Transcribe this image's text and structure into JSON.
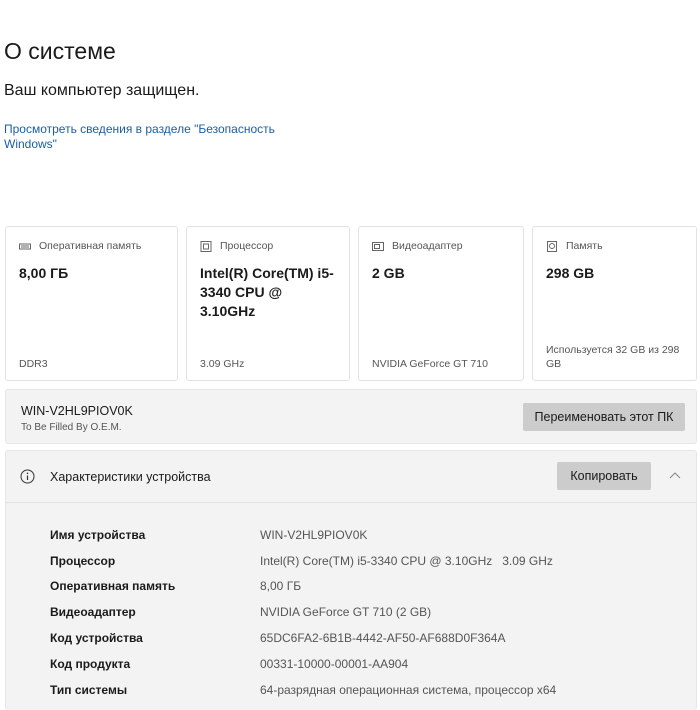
{
  "page": {
    "title": "О системе",
    "protection_status": "Ваш компьютер защищен.",
    "security_link": "Просмотреть сведения в разделе \"Безопасность Windows\""
  },
  "cards": [
    {
      "icon": "ram-icon",
      "label": "Оперативная память",
      "value": "8,00 ГБ",
      "sub": "DDR3"
    },
    {
      "icon": "cpu-icon",
      "label": "Процессор",
      "value": "Intel(R) Core(TM) i5-3340 CPU @ 3.10GHz",
      "sub": "3.09 GHz"
    },
    {
      "icon": "gpu-icon",
      "label": "Видеоадаптер",
      "value": "2 GB",
      "sub": "NVIDIA GeForce GT 710"
    },
    {
      "icon": "storage-icon",
      "label": "Память",
      "value": "298 GB",
      "sub": "Используется 32 GB из 298 GB"
    }
  ],
  "device": {
    "name": "WIN-V2HL9PIOV0K",
    "model": "To Be Filled By O.E.M.",
    "rename_label": "Переименовать этот ПК"
  },
  "specs": {
    "title": "Характеристики устройства",
    "copy_label": "Копировать",
    "rows": [
      {
        "key": "Имя устройства",
        "value": "WIN-V2HL9PIOV0K"
      },
      {
        "key": "Процессор",
        "value": "Intel(R) Core(TM) i5-3340 CPU @ 3.10GHz   3.09 GHz"
      },
      {
        "key": "Оперативная память",
        "value": "8,00 ГБ"
      },
      {
        "key": "Видеоадаптер",
        "value": "NVIDIA GeForce GT 710 (2 GB)"
      },
      {
        "key": "Код устройства",
        "value": "65DC6FA2-6B1B-4442-AF50-AF688D0F364A"
      },
      {
        "key": "Код продукта",
        "value": "00331-10000-00001-AA904"
      },
      {
        "key": "Тип системы",
        "value": "64-разрядная операционная система, процессор x64"
      }
    ]
  },
  "colors": {
    "link": "#1a5fa6",
    "panel": "#f3f3f3",
    "button": "#cccccc"
  }
}
